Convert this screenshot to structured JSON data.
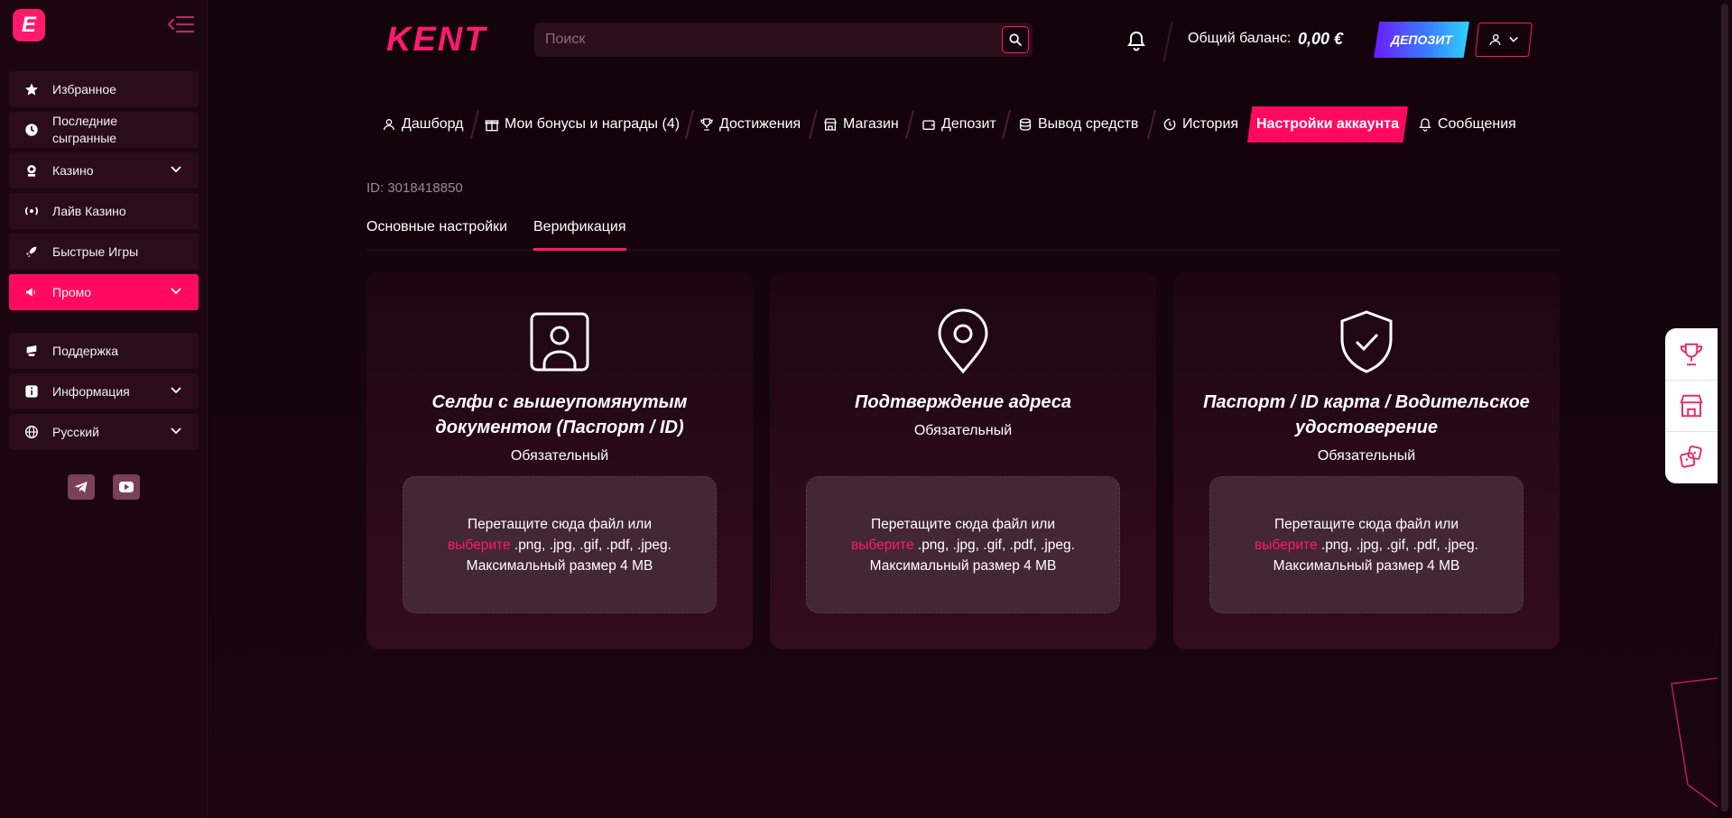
{
  "sidebar": {
    "items": [
      {
        "label": "Избранное",
        "icon": "star-icon"
      },
      {
        "label": "Последние\nсыгранные",
        "icon": "clock-icon"
      },
      {
        "label": "Казино",
        "icon": "casino-icon"
      },
      {
        "label": "Лайв Казино",
        "icon": "live-icon"
      },
      {
        "label": "Быстрые Игры",
        "icon": "rocket-icon"
      },
      {
        "label": "Промо",
        "icon": "megaphone-icon"
      },
      {
        "label": "Поддержка",
        "icon": "support-icon"
      },
      {
        "label": "Информация",
        "icon": "info-icon"
      },
      {
        "label": "Русский",
        "icon": "globe-icon"
      }
    ],
    "active_color": "#ff0a60"
  },
  "header": {
    "brand": "KENT",
    "search_placeholder": "Поиск",
    "balance_label": "Общий баланс:",
    "balance_value": "0,00 €",
    "deposit_label": "ДЕПОЗИТ"
  },
  "account_tabs": [
    {
      "label": "Дашборд"
    },
    {
      "label": "Мои бонусы и награды (4)"
    },
    {
      "label": "Достижения"
    },
    {
      "label": "Магазин"
    },
    {
      "label": "Депозит"
    },
    {
      "label": "Вывод средств"
    },
    {
      "label": "История"
    },
    {
      "label": "Настройки аккаунта"
    },
    {
      "label": "Сообщения"
    }
  ],
  "account": {
    "id_text": "ID: 3018418850",
    "sub_tabs": [
      "Основные настройки",
      "Верификация"
    ]
  },
  "cards": [
    {
      "title": "Селфи с вышеупомянутым документом (Паспорт / ID)",
      "required": "Обязательный",
      "icon": "selfie-id-icon"
    },
    {
      "title": "Подтверждение адреса",
      "required": "Обязательный",
      "icon": "location-pin-icon"
    },
    {
      "title": "Паспорт / ID карта / Водительское удостоверение",
      "required": "Обязательный",
      "icon": "shield-check-icon"
    }
  ],
  "dropzone": {
    "line1": "Перетащите сюда файл или",
    "pick": "выберите",
    "formats": " .png, .jpg, .gif, .pdf, .jpeg.",
    "max": "Максимальный размер 4 MB"
  },
  "colors": {
    "accent": "#ff1a6c",
    "background": "#14040b"
  }
}
